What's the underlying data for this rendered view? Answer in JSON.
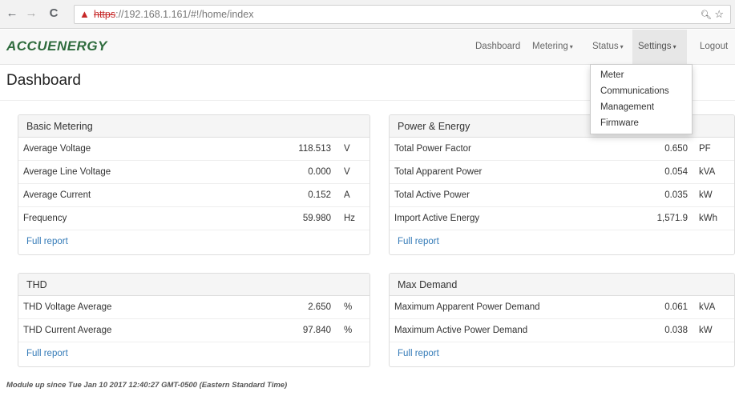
{
  "browser": {
    "back_icon": "←",
    "forward_icon": "→",
    "reload_icon": "C",
    "warning_icon": "▲",
    "url_scheme": "https",
    "url_rest": "://192.168.1.161/#!/home/index",
    "zoom_icon": "🔍",
    "star_icon": "☆"
  },
  "navbar": {
    "logo": "ACCUENERGY",
    "items": [
      {
        "label": "Dashboard",
        "caret": ""
      },
      {
        "label": "Metering",
        "caret": "▾"
      },
      {
        "label": "Status",
        "caret": "▾"
      },
      {
        "label": "Settings",
        "caret": "▾"
      },
      {
        "label": "Logout",
        "caret": ""
      }
    ]
  },
  "settings_menu": [
    "Meter",
    "Communications",
    "Management",
    "Firmware"
  ],
  "page_title": "Dashboard",
  "panels": {
    "basic_metering": {
      "title": "Basic Metering",
      "rows": [
        {
          "label": "Average Voltage",
          "value": "118.513",
          "unit": "V"
        },
        {
          "label": "Average Line Voltage",
          "value": "0.000",
          "unit": "V"
        },
        {
          "label": "Average Current",
          "value": "0.152",
          "unit": "A"
        },
        {
          "label": "Frequency",
          "value": "59.980",
          "unit": "Hz"
        }
      ],
      "link": "Full report"
    },
    "power_energy": {
      "title": "Power & Energy",
      "rows": [
        {
          "label": "Total Power Factor",
          "value": "0.650",
          "unit": "PF"
        },
        {
          "label": "Total Apparent Power",
          "value": "0.054",
          "unit": "kVA"
        },
        {
          "label": "Total Active Power",
          "value": "0.035",
          "unit": "kW"
        },
        {
          "label": "Import Active Energy",
          "value": "1,571.9",
          "unit": "kWh"
        }
      ],
      "link": "Full report"
    },
    "thd": {
      "title": "THD",
      "rows": [
        {
          "label": "THD Voltage Average",
          "value": "2.650",
          "unit": "%"
        },
        {
          "label": "THD Current Average",
          "value": "97.840",
          "unit": "%"
        }
      ],
      "link": "Full report"
    },
    "max_demand": {
      "title": "Max Demand",
      "rows": [
        {
          "label": "Maximum Apparent Power Demand",
          "value": "0.061",
          "unit": "kVA"
        },
        {
          "label": "Maximum Active Power Demand",
          "value": "0.038",
          "unit": "kW"
        }
      ],
      "link": "Full report"
    }
  },
  "module_status": "Module up since Tue Jan 10 2017 12:40:27 GMT-0500 (Eastern Standard Time)"
}
